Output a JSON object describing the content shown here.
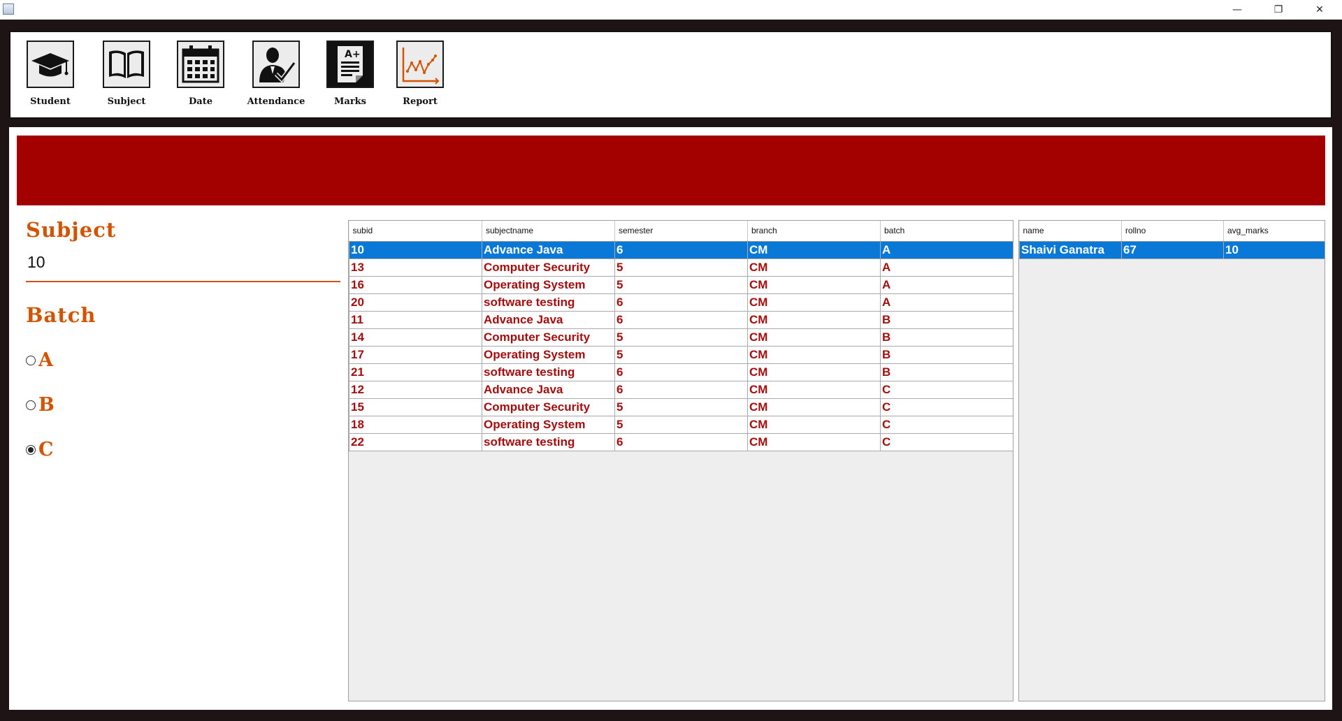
{
  "window": {
    "minimize": "—",
    "restore": "❐",
    "close": "✕"
  },
  "toolbar": {
    "items": [
      {
        "label": "Student",
        "icon": "graduation-cap-icon"
      },
      {
        "label": "Subject",
        "icon": "open-book-icon"
      },
      {
        "label": "Date",
        "icon": "calendar-icon"
      },
      {
        "label": "Attendance",
        "icon": "person-check-icon"
      },
      {
        "label": "Marks",
        "icon": "grade-sheet-icon"
      },
      {
        "label": "Report",
        "icon": "line-chart-icon"
      }
    ]
  },
  "colors": {
    "banner": "#a30000",
    "accent": "#d35400",
    "cell_text": "#a50e0e",
    "selection": "#0a78d7"
  },
  "form": {
    "subject_heading": "Subject",
    "subject_value": "10",
    "batch_heading": "Batch",
    "batch_options": [
      "A",
      "B",
      "C"
    ],
    "batch_selected": "C"
  },
  "subject_table": {
    "columns": [
      "subid",
      "subjectname",
      "semester",
      "branch",
      "batch"
    ],
    "selected_row": 0,
    "rows": [
      [
        "10",
        "Advance Java",
        "6",
        "CM",
        "A"
      ],
      [
        "13",
        "Computer Security",
        "5",
        "CM",
        "A"
      ],
      [
        "16",
        "Operating System",
        "5",
        "CM",
        "A"
      ],
      [
        "20",
        "software testing",
        "6",
        "CM",
        "A"
      ],
      [
        "11",
        "Advance Java",
        "6",
        "CM",
        "B"
      ],
      [
        "14",
        "Computer Security",
        "5",
        "CM",
        "B"
      ],
      [
        "17",
        "Operating System",
        "5",
        "CM",
        "B"
      ],
      [
        "21",
        "software testing",
        "6",
        "CM",
        "B"
      ],
      [
        "12",
        "Advance Java",
        "6",
        "CM",
        "C"
      ],
      [
        "15",
        "Computer Security",
        "5",
        "CM",
        "C"
      ],
      [
        "18",
        "Operating System",
        "5",
        "CM",
        "C"
      ],
      [
        "22",
        "software testing",
        "6",
        "CM",
        "C"
      ]
    ]
  },
  "student_table": {
    "columns": [
      "name",
      "rollno",
      "avg_marks"
    ],
    "selected_row": 0,
    "rows": [
      [
        "Shaivi Ganatra",
        "67",
        "10"
      ]
    ]
  }
}
